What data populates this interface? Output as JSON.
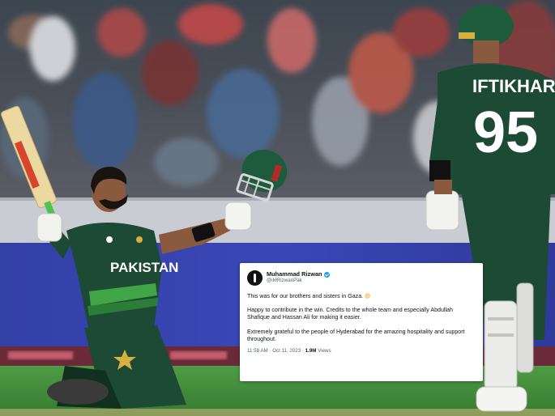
{
  "photo": {
    "jersey_back_name": "IFTIKHAR",
    "jersey_back_number": "95",
    "jersey_front_text": "PAKISTAN"
  },
  "tweet": {
    "author_name": "Muhammad Rizwan",
    "author_handle": "@iMRizwanPak",
    "paragraphs": [
      "This was for our brothers and sisters in Gaza.",
      "Happy to contribute in the win. Credits to the whole team and especially Abdullah Shafique and Hassan Ali for making it easier.",
      "Extremely grateful to the people of Hyderabad for the amazing hospitality and support throughout."
    ],
    "time": "11:58 AM",
    "date": "Oct 11, 2023",
    "views_count": "1.9M",
    "views_label": "Views"
  },
  "colors": {
    "jersey_green": "#1d4a34",
    "jersey_green_dark": "#12301f",
    "helmet_green": "#1e5a3c",
    "grass": "#3d8a3a",
    "board_blue": "#3a3fa8",
    "twitter_blue": "#1d9bf0"
  }
}
